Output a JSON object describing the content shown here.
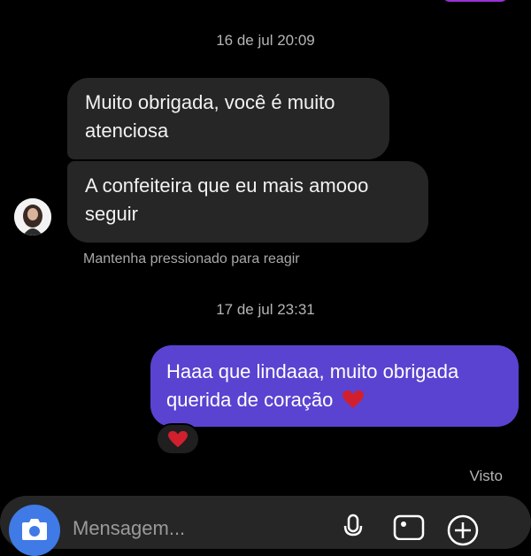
{
  "conversation": {
    "timestamp1": "16 de jul 20:09",
    "incoming_1": "Muito obrigada, você é muito atenciosa",
    "incoming_2": "A confeiteira que eu mais amooo seguir",
    "hint": "Mantenha pressionado para reagir",
    "timestamp2": "17 de jul 23:31",
    "outgoing_1": "Haaa que lindaaa, muito obrigada querida de coração",
    "outgoing_emoji": "❤️",
    "reaction": "❤️",
    "seen": "Visto"
  },
  "composer": {
    "placeholder": "Mensagem...",
    "camera_icon": "camera-icon",
    "mic_icon": "microphone-icon",
    "gallery_icon": "gallery-icon",
    "add_icon": "add-circle-icon"
  },
  "colors": {
    "background": "#000000",
    "incoming_bubble": "#262626",
    "outgoing_bubble": "#5a43d1",
    "camera_button": "#3f7ae6",
    "heart": "#d0202e"
  }
}
